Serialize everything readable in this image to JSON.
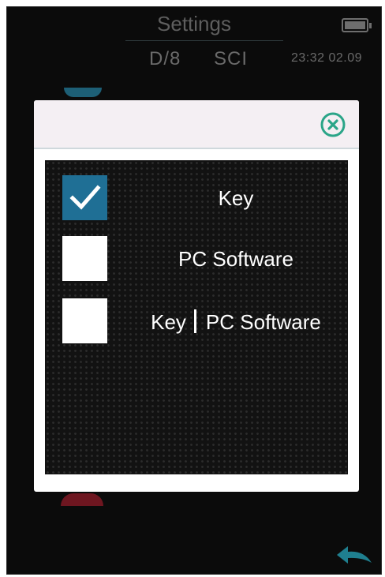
{
  "header": {
    "title": "Settings",
    "measurement_geometry": "D/8",
    "specular_mode": "SCI",
    "time": "23:32",
    "date": "02.09",
    "battery_icon": "battery-full-icon"
  },
  "dialog": {
    "close_icon": "close-circle-icon",
    "accent_color": "#1f6f95",
    "options": [
      {
        "label": "Key",
        "checked": true
      },
      {
        "label": "PC Software",
        "checked": false
      },
      {
        "label_part1": "Key",
        "label_part2": "PC Software",
        "checked": false
      }
    ]
  },
  "footer": {
    "back_icon": "back-arrow-icon"
  }
}
